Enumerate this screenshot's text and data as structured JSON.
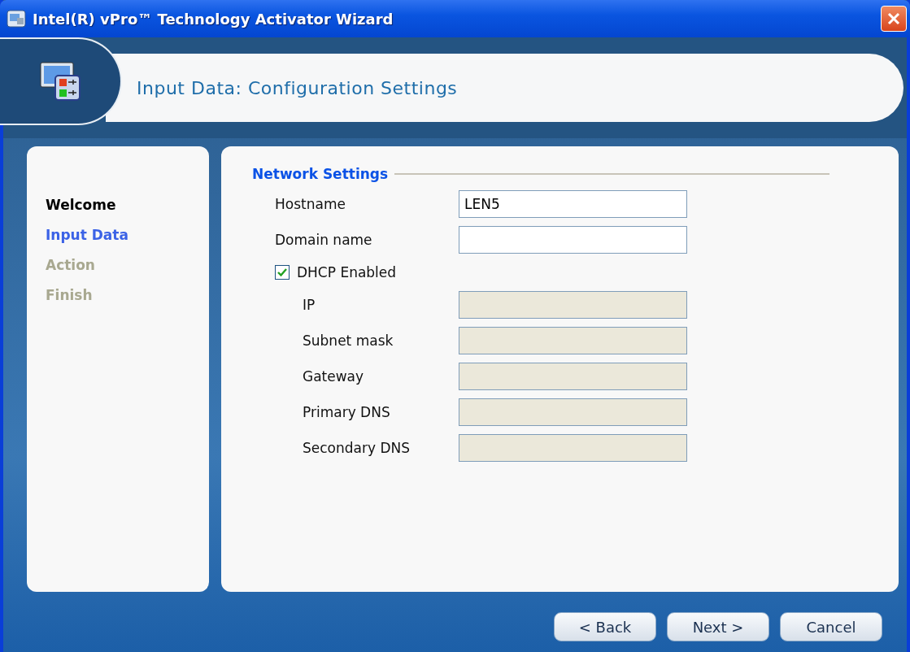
{
  "window": {
    "title": "Intel(R) vPro™ Technology Activator Wizard"
  },
  "header": {
    "title": "Input Data: Configuration Settings"
  },
  "steps": [
    {
      "label": "Welcome",
      "selected": false,
      "disabled": false
    },
    {
      "label": "Input Data",
      "selected": true,
      "disabled": false
    },
    {
      "label": "Action",
      "selected": false,
      "disabled": true
    },
    {
      "label": "Finish",
      "selected": false,
      "disabled": true
    }
  ],
  "network": {
    "title": "Network Settings",
    "fields": [
      {
        "label": "Hostname",
        "value": "LEN5",
        "disabled": false
      },
      {
        "label": "Domain name",
        "disabled": false
      }
    ],
    "dhcp": {
      "label": "DHCP Enabled",
      "checked": true,
      "children": [
        {
          "label": "IP",
          "disabled": true
        },
        {
          "label": "Subnet mask",
          "disabled": true
        },
        {
          "label": "Gateway",
          "disabled": true
        },
        {
          "label": "Primary DNS",
          "disabled": true
        },
        {
          "label": "Secondary DNS",
          "disabled": true
        }
      ]
    }
  },
  "buttons": [
    "< Back",
    "Next >",
    "Cancel"
  ]
}
